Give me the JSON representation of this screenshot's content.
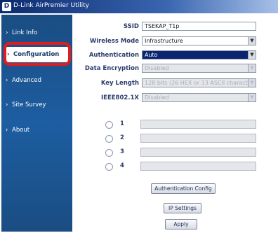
{
  "window": {
    "title": "D-Link AirPremier Utility",
    "icon": "d-link-logo-icon"
  },
  "sidebar": {
    "items": [
      {
        "label": "Link Info",
        "bullet": "›"
      },
      {
        "label": "Configuration",
        "bullet": "›"
      },
      {
        "label": "Advanced",
        "bullet": "›"
      },
      {
        "label": "Site Survey",
        "bullet": "›"
      },
      {
        "label": "About",
        "bullet": "›"
      }
    ],
    "selected": "Configuration",
    "highlight_color": "#e21b1b"
  },
  "config": {
    "ssid": {
      "label": "SSID",
      "value": "TSEKAP_T1p"
    },
    "wireless_mode": {
      "label": "Wireless Mode",
      "value": "Infrastructure"
    },
    "authentication": {
      "label": "Authentication",
      "value": "Auto"
    },
    "data_encryption": {
      "label": "Data Encryption",
      "value": "Disabled"
    },
    "key_length": {
      "label": "Key Length",
      "value": "128 bits (26 HEX or 13 ASCII characters)"
    },
    "ieee8021x": {
      "label": "IEEE802.1X",
      "value": "Disabled"
    }
  },
  "keys": [
    {
      "number": "1"
    },
    {
      "number": "2"
    },
    {
      "number": "3"
    },
    {
      "number": "4"
    }
  ],
  "buttons": {
    "auth_config": "Authentication Config",
    "ip_settings": "IP Settings",
    "apply": "Apply"
  }
}
